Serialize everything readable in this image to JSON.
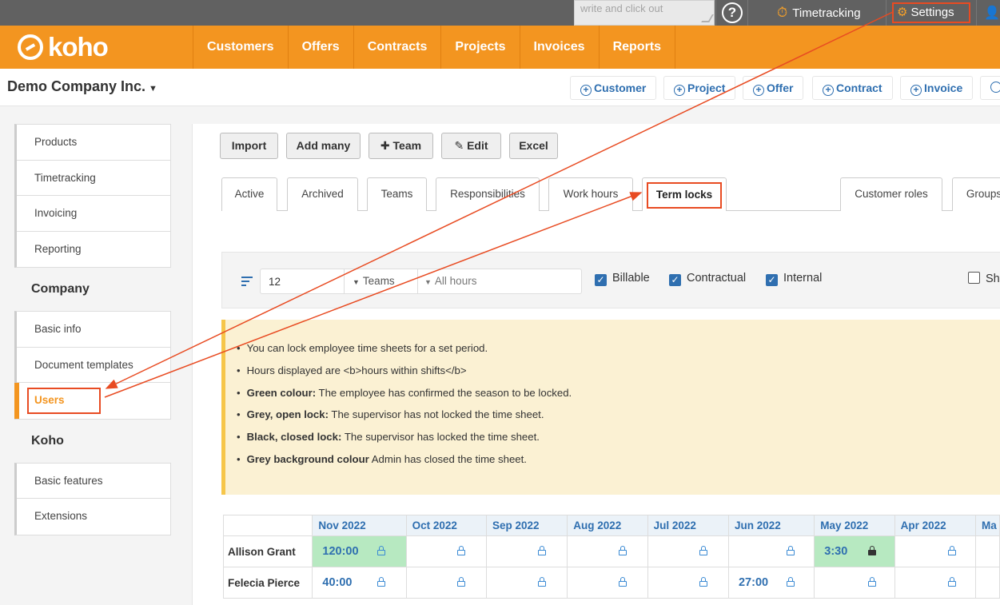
{
  "topbar": {
    "note_placeholder": "write and click out",
    "help_label": "?",
    "timetracking_label": "Timetracking",
    "settings_label": "Settings"
  },
  "nav": {
    "logo_text": "koho",
    "items": [
      "Customers",
      "Offers",
      "Contracts",
      "Projects",
      "Invoices",
      "Reports"
    ]
  },
  "company_bar": {
    "company_name": "Demo Company Inc.",
    "quick_add": [
      "Customer",
      "Project",
      "Offer",
      "Contract",
      "Invoice"
    ]
  },
  "sidebar": {
    "group1": [
      "Products",
      "Timetracking",
      "Invoicing",
      "Reporting"
    ],
    "company_heading": "Company",
    "group2": [
      "Basic info",
      "Document templates",
      "Users"
    ],
    "koho_heading": "Koho",
    "group3": [
      "Basic features",
      "Extensions"
    ]
  },
  "toolbar": {
    "import": "Import",
    "add_many": "Add many",
    "team": "Team",
    "edit": "Edit",
    "excel": "Excel"
  },
  "tabs": [
    "Active",
    "Archived",
    "Teams",
    "Responsibilities",
    "Work hours",
    "Term locks",
    "Customer roles",
    "Groups"
  ],
  "filter": {
    "months_value": "12",
    "teams_label": "Teams",
    "hours_label": "All hours",
    "billable": "Billable",
    "contractual": "Contractual",
    "internal": "Internal",
    "show": "Sho"
  },
  "info": {
    "lines": [
      {
        "bold": "",
        "text": "You can lock employee time sheets for a set period."
      },
      {
        "bold": "",
        "text": "Hours displayed are <b>hours within shifts</b>"
      },
      {
        "bold": "Green colour:",
        "text": "The employee has confirmed the season to be locked."
      },
      {
        "bold": "Grey, open lock:",
        "text": "The supervisor has not locked the time sheet."
      },
      {
        "bold": "Black, closed lock:",
        "text": "The supervisor has locked the time sheet."
      },
      {
        "bold": "Grey background colour",
        "text": "Admin has closed the time sheet."
      }
    ]
  },
  "table": {
    "months": [
      "Nov 2022",
      "Oct 2022",
      "Sep 2022",
      "Aug 2022",
      "Jul 2022",
      "Jun 2022",
      "May 2022",
      "Apr 2022",
      "Ma"
    ],
    "rows": [
      {
        "name": "Allison Grant",
        "cells": [
          "120:00",
          "",
          "",
          "",
          "",
          "",
          "3:30",
          "",
          ""
        ]
      },
      {
        "name": "Felecia Pierce",
        "cells": [
          "40:00",
          "",
          "",
          "",
          "",
          "27:00",
          "",
          "",
          ""
        ]
      }
    ]
  }
}
